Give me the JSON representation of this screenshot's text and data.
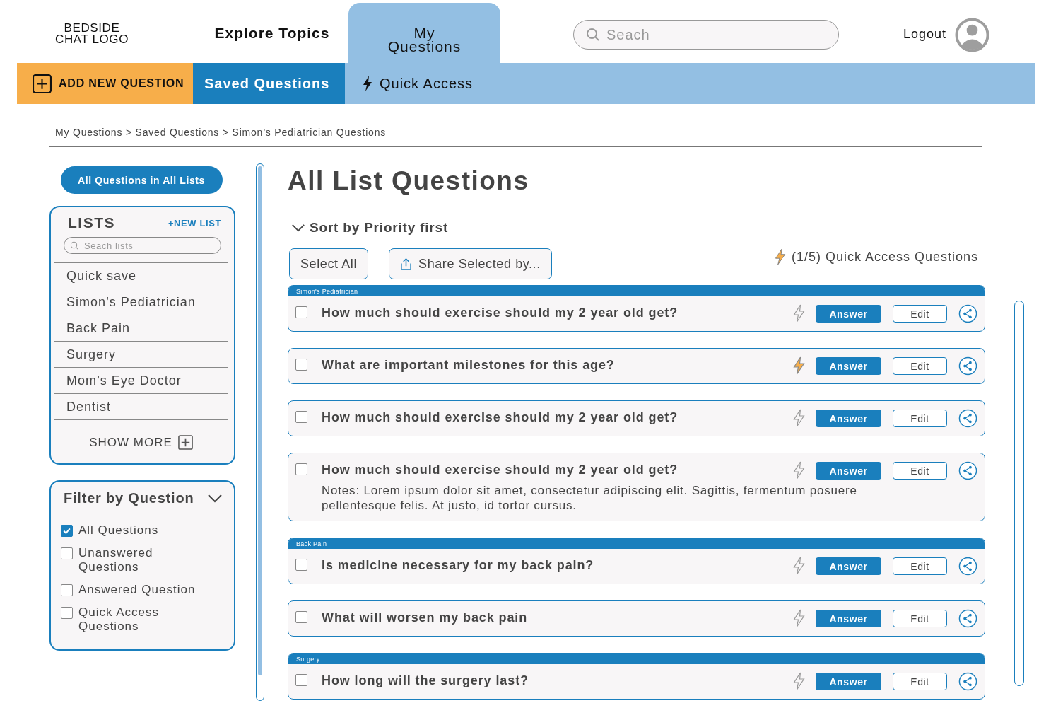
{
  "header": {
    "logo": [
      "BEDSIDE",
      "CHAT LOGO"
    ],
    "nav_tabs": [
      {
        "label": "Explore Topics",
        "selected": false
      },
      {
        "label": "My Questions",
        "selected": true
      }
    ],
    "search": {
      "placeholder": "Seach"
    },
    "logout": "Logout"
  },
  "subnav": {
    "add_button": "ADD NEW QUESTION",
    "tabs": [
      {
        "label": "Saved Questions",
        "selected": true,
        "kind": "plain"
      },
      {
        "label": "Quick Access",
        "selected": false,
        "kind": "bolt"
      }
    ]
  },
  "breadcrumb": "My Questions > Saved Questions > Simon’s Pediatrician Questions",
  "sidebar": {
    "all_button": "All Questions in All Lists",
    "lists": {
      "title": "LISTS",
      "new_list": "+NEW LIST",
      "search_placeholder": "Seach lists",
      "items": [
        "Quick save",
        "Simon’s Pediatrician",
        "Back Pain",
        "Surgery",
        "Mom’s Eye Doctor",
        "Dentist"
      ],
      "show_more": "SHOW MORE"
    },
    "filter": {
      "title": "Filter by Question",
      "options": [
        {
          "label": "All Questions",
          "checked": true
        },
        {
          "label": "Unanswered Questions",
          "checked": false
        },
        {
          "label": "Answered Question",
          "checked": false
        },
        {
          "label": "Quick Access Questions",
          "checked": false
        }
      ]
    }
  },
  "main": {
    "title": "All List Questions",
    "sort": "Sort by Priority first",
    "select_all": "Select All",
    "share": "Share Selected by...",
    "quick_access_count": "(1/5) Quick Access Questions",
    "questions": [
      {
        "list_tag": "Simon's Pediatrician",
        "text": "How much should exercise should my 2 year old get?",
        "quick_access": false,
        "checked": false,
        "answer": "Answer",
        "edit": "Edit"
      },
      {
        "text": "What are important milestones for this age?",
        "quick_access": true,
        "checked": false,
        "answer": "Answer",
        "edit": "Edit"
      },
      {
        "text": "How much should exercise should my 2 year old get?",
        "quick_access": false,
        "checked": false,
        "answer": "Answer",
        "edit": "Edit"
      },
      {
        "text": "How much should exercise should my 2 year old get?",
        "notes": "Notes: Lorem ipsum dolor sit amet, consectetur adipiscing elit. Sagittis, fermentum posuere pellentesque felis. At justo, id tortor cursus.",
        "quick_access": false,
        "checked": false,
        "answer": "Answer",
        "edit": "Edit"
      },
      {
        "list_tag": "Back Pain",
        "text": "Is medicine necessary for my back pain?",
        "quick_access": false,
        "checked": false,
        "answer": "Answer",
        "edit": "Edit"
      },
      {
        "text": "What will worsen my back pain",
        "quick_access": false,
        "checked": false,
        "answer": "Answer",
        "edit": "Edit"
      },
      {
        "list_tag": "Surgery",
        "text": "How long will the surgery last?",
        "quick_access": false,
        "checked": false,
        "answer": "Answer",
        "edit": "Edit"
      }
    ]
  }
}
